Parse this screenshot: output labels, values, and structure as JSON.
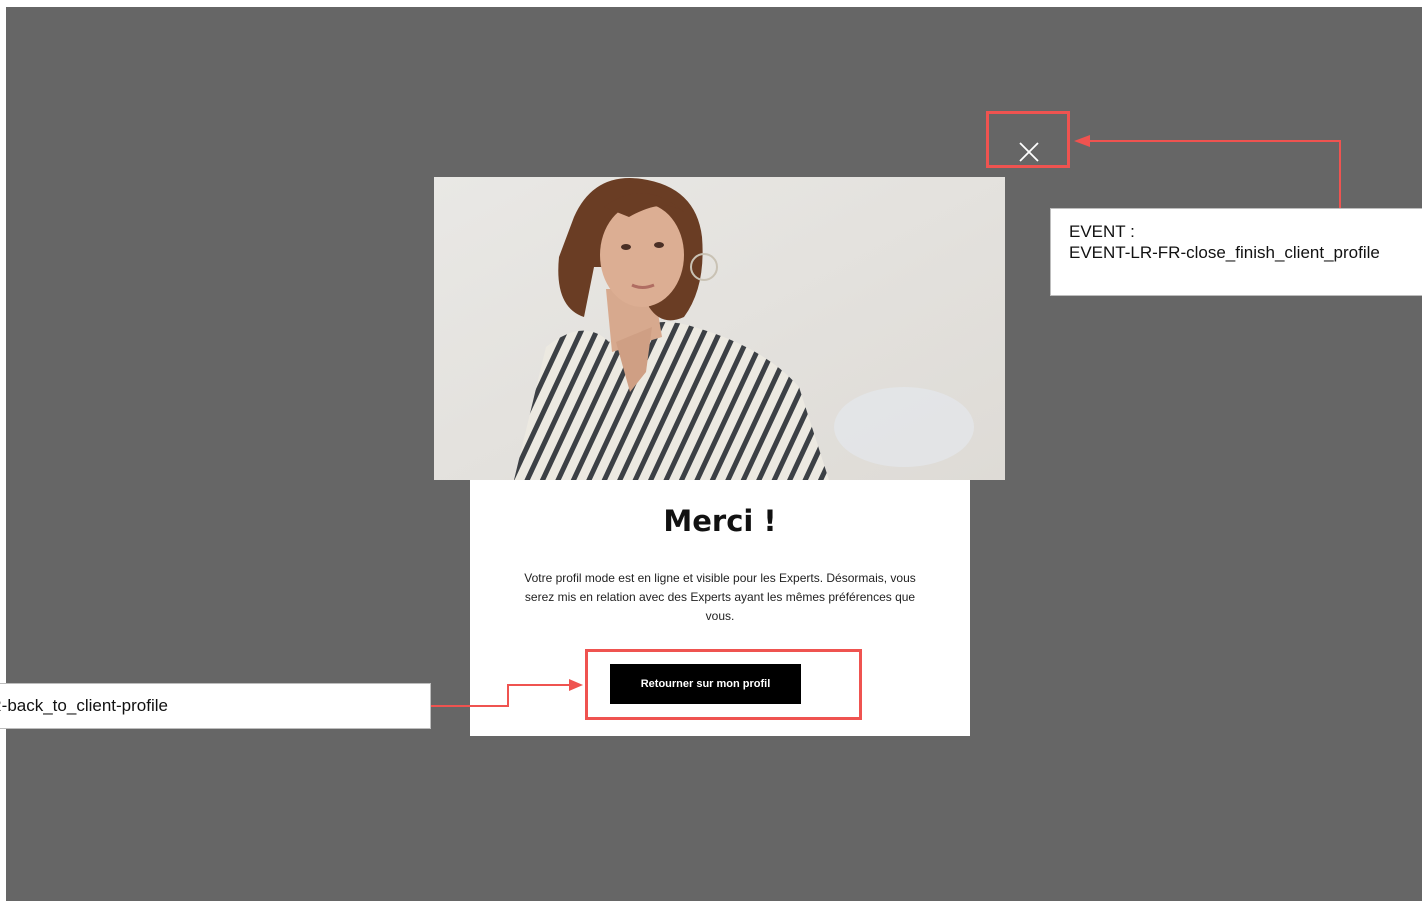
{
  "modal": {
    "close_icon": "close-icon",
    "title": "Merci !",
    "body": "Votre profil mode est en ligne et visible pour les Experts. Désormais, vous serez mis en relation avec des Experts ayant les mêmes préférences que vous.",
    "cta_label": "Retourner sur mon profil"
  },
  "annotations": {
    "close_event": {
      "label": "EVENT :",
      "name": "EVENT-LR-FR-close_finish_client_profile"
    },
    "cta_event": {
      "name": "FR-back_to_client-profile"
    }
  },
  "colors": {
    "overlay": "#666666",
    "highlight": "#ef5350",
    "cta_background": "#000000",
    "card_background": "#ffffff"
  }
}
